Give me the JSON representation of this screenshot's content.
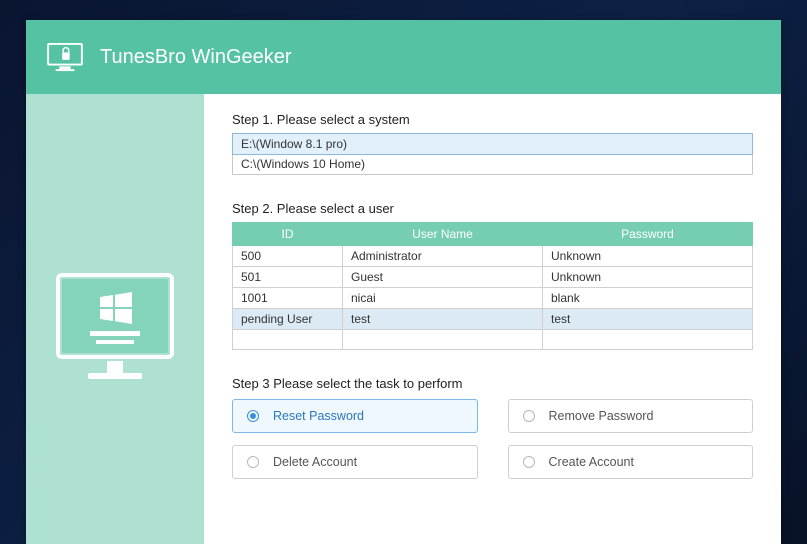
{
  "header": {
    "title": "TunesBro WinGeeker"
  },
  "step1": {
    "label": "Step 1. Please select a system",
    "systems": [
      {
        "text": "E:\\(Window 8.1 pro)",
        "selected": true
      },
      {
        "text": "C:\\(Windows 10 Home)",
        "selected": false
      }
    ]
  },
  "step2": {
    "label": "Step 2. Please select a user",
    "columns": {
      "id": "ID",
      "username": "User Name",
      "password": "Password"
    },
    "users": [
      {
        "id": "500",
        "username": "Administrator",
        "password": "Unknown",
        "selected": false
      },
      {
        "id": "501",
        "username": "Guest",
        "password": "Unknown",
        "selected": false
      },
      {
        "id": "1001",
        "username": "nicai",
        "password": "blank",
        "selected": false
      },
      {
        "id": "pending User",
        "username": "test",
        "password": "test",
        "selected": true
      }
    ]
  },
  "step3": {
    "label": "Step 3  Please select the task to perform",
    "tasks": [
      {
        "key": "reset",
        "label": "Reset Password",
        "selected": true
      },
      {
        "key": "remove",
        "label": "Remove Password",
        "selected": false
      },
      {
        "key": "delete",
        "label": "Delete Account",
        "selected": false
      },
      {
        "key": "create",
        "label": "Create Account",
        "selected": false
      }
    ]
  }
}
